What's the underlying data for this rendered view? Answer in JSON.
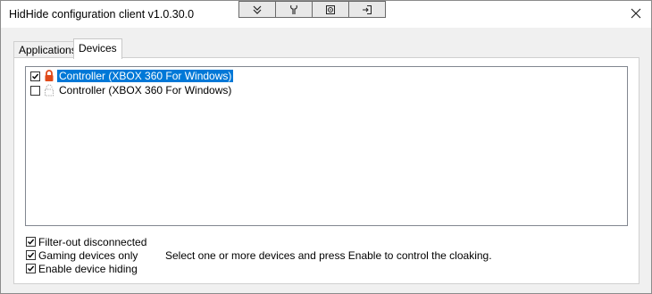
{
  "window": {
    "title": "HidHide configuration client v1.0.30.0"
  },
  "toolbar": {
    "buttons": [
      {
        "icon": "chevrons-down-icon"
      },
      {
        "icon": "wrench-icon"
      },
      {
        "icon": "target-icon"
      },
      {
        "icon": "sign-in-icon"
      }
    ]
  },
  "tabs": [
    {
      "label": "Applications",
      "active": false
    },
    {
      "label": "Devices",
      "active": true
    }
  ],
  "devices": [
    {
      "label": "Controller (XBOX 360 For Windows)",
      "checked": true,
      "selected": true,
      "icon": "lock-icon"
    },
    {
      "label": "Controller (XBOX 360 For Windows)",
      "checked": false,
      "selected": false,
      "icon": "unlocked-outline-icon"
    }
  ],
  "options": [
    {
      "label": "Filter-out disconnected",
      "checked": true
    },
    {
      "label": "Gaming devices only",
      "checked": true
    },
    {
      "label": "Enable device hiding",
      "checked": true
    }
  ],
  "hint_text": "Select one or more devices and press Enable to control the cloaking.",
  "colors": {
    "selection": "#0078d7",
    "lock": "#e04a1a"
  }
}
